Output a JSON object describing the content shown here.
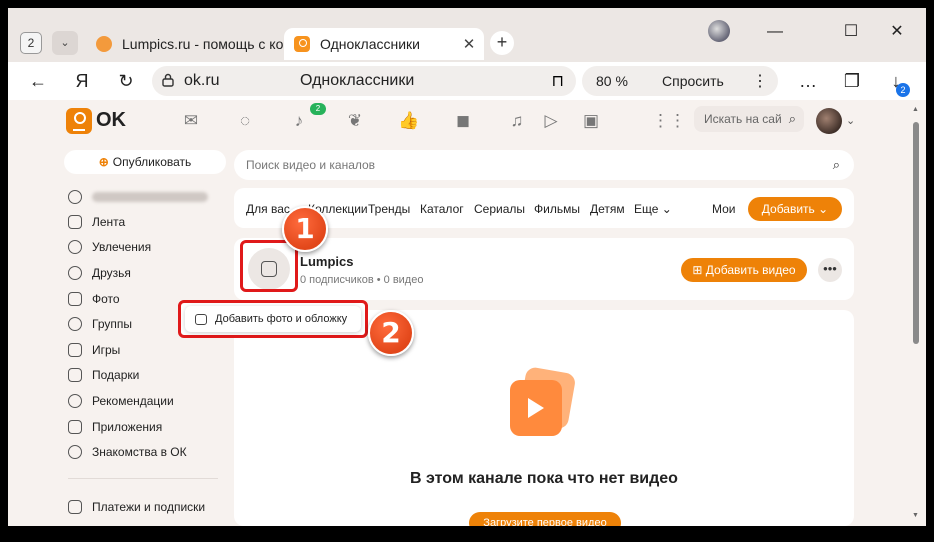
{
  "browser": {
    "tab_count": "2",
    "tabs": [
      {
        "title": "Lumpics.ru - помощь с ком",
        "close": "✕"
      },
      {
        "title": "Одноклассники",
        "close": "✕"
      }
    ],
    "new_tab": "+",
    "window": {
      "minimize": "—",
      "maximize": "☐",
      "close": "✕"
    },
    "address": {
      "url": "ok.ru",
      "page_title": "Одноклассники"
    },
    "zoom": "80 %",
    "ask_label": "Спросить",
    "download_badge": "2"
  },
  "header": {
    "logo_text": "OK",
    "notifications_count": "2",
    "search_placeholder": "Искать на сай"
  },
  "sidebar": {
    "publish_label": "Опубликовать",
    "items": [
      {
        "label": "Лента"
      },
      {
        "label": "Увлечения"
      },
      {
        "label": "Друзья"
      },
      {
        "label": "Фото"
      },
      {
        "label": "Группы"
      },
      {
        "label": "Игры"
      },
      {
        "label": "Подарки"
      },
      {
        "label": "Рекомендации"
      },
      {
        "label": "Приложения"
      },
      {
        "label": "Знакомства в ОК"
      }
    ],
    "payments": "Платежи и подписки"
  },
  "video": {
    "search_placeholder": "Поиск видео и каналов",
    "tabs": [
      "Для вас",
      "Коллекции",
      "Тренды",
      "Каталог",
      "Сериалы",
      "Фильмы",
      "Детям",
      "Еще"
    ],
    "mine": "Мои",
    "add_button": "Добавить"
  },
  "channel": {
    "name": "Lumpics",
    "meta": "0 подписчиков • 0 видео",
    "add_video": "Добавить видео",
    "more": "•••"
  },
  "empty_state": {
    "title": "В этом канале пока что нет видео",
    "upload_button": "Загрузите первое видео"
  },
  "popup": {
    "label": "Добавить фото и обложку"
  },
  "annotations": {
    "step1": "1",
    "step2": "2",
    "highlight_color": "#e0191a",
    "callout_color": "#e2471a"
  },
  "colors": {
    "accent": "#ee8208",
    "badge": "#27b25a"
  }
}
